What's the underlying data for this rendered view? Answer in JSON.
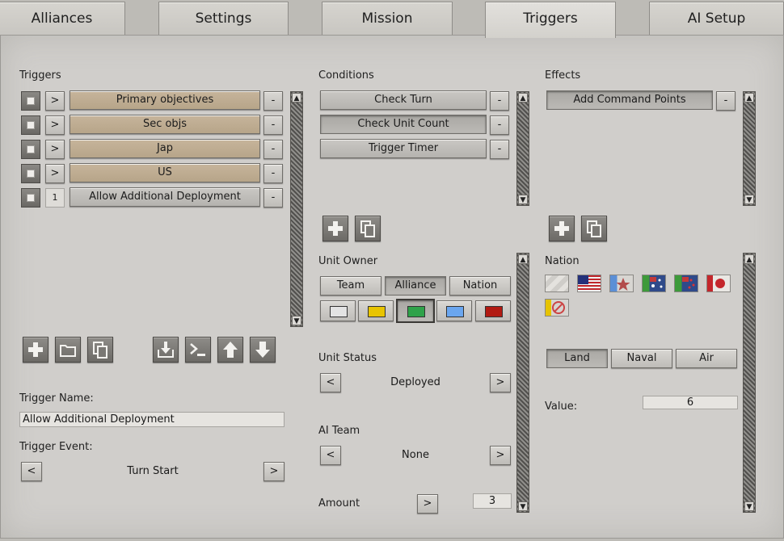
{
  "tabs": [
    "Alliances",
    "Settings",
    "Mission",
    "Triggers",
    "AI Setup"
  ],
  "active_tab": "Triggers",
  "triggers": {
    "heading": "Triggers",
    "items": [
      {
        "toggle": ">",
        "label": "Primary objectives",
        "remove": "-"
      },
      {
        "toggle": ">",
        "label": "Sec objs",
        "remove": "-"
      },
      {
        "toggle": ">",
        "label": "Jap",
        "remove": "-"
      },
      {
        "toggle": ">",
        "label": "US",
        "remove": "-"
      },
      {
        "toggle": "1",
        "label": "Allow Additional Deployment",
        "remove": "-"
      }
    ],
    "name_label": "Trigger Name:",
    "name_value": "Allow Additional Deployment",
    "event_label": "Trigger Event:",
    "event_value": "Turn Start",
    "prev": "<",
    "next": ">"
  },
  "conditions": {
    "heading": "Conditions",
    "items": [
      {
        "label": "Check Turn",
        "remove": "-"
      },
      {
        "label": "Check Unit Count",
        "remove": "-"
      },
      {
        "label": "Trigger Timer",
        "remove": "-"
      }
    ],
    "unit_owner_label": "Unit Owner",
    "owner_modes": [
      "Team",
      "Alliance",
      "Nation"
    ],
    "selected_owner_mode": "Alliance",
    "team_colors": [
      "#e3e3e3",
      "#e8c400",
      "#2fa24a",
      "#6aa6ef",
      "#b21a12"
    ],
    "selected_team_color": "#2fa24a",
    "unit_status_label": "Unit Status",
    "unit_status_value": "Deployed",
    "ai_team_label": "AI Team",
    "ai_team_value": "None",
    "amount_label": "Amount",
    "amount_button": ">",
    "amount_value": "3",
    "prev": "<",
    "next": ">"
  },
  "effects": {
    "heading": "Effects",
    "items": [
      {
        "label": "Add Command Points",
        "remove": "-"
      }
    ],
    "nation_label": "Nation",
    "domains": [
      "Land",
      "Naval",
      "Air"
    ],
    "selected_domain": "Land",
    "value_label": "Value:",
    "value": "6"
  },
  "icons": {
    "scroll_up": "▲",
    "scroll_down": "▼"
  }
}
